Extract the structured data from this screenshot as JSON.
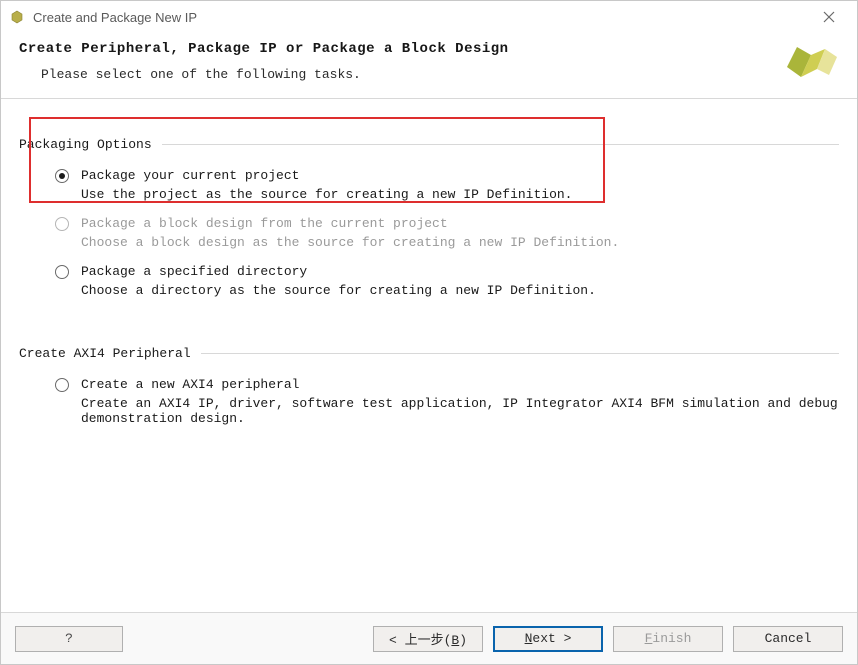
{
  "window": {
    "title": "Create and Package New IP"
  },
  "header": {
    "heading": "Create Peripheral, Package IP or Package a Block Design",
    "subhead": "Please select one of the following tasks."
  },
  "sections": {
    "packaging": {
      "title": "Packaging Options",
      "options": [
        {
          "line1": "Package your current project",
          "line2": "Use the project as the source for creating a new IP Definition.",
          "selected": true,
          "disabled": false
        },
        {
          "line1": "Package a block design from the current project",
          "line2": "Choose a block design as the source for creating a new IP Definition.",
          "selected": false,
          "disabled": true
        },
        {
          "line1": "Package a specified directory",
          "line2": "Choose a directory as the source for creating a new IP Definition.",
          "selected": false,
          "disabled": false
        }
      ]
    },
    "axi": {
      "title": "Create AXI4 Peripheral",
      "options": [
        {
          "line1": "Create a new AXI4 peripheral",
          "line2": "Create an AXI4 IP, driver, software test application, IP Integrator AXI4 BFM simulation and debug demonstration design.",
          "selected": false,
          "disabled": false
        }
      ]
    }
  },
  "footer": {
    "help": "?",
    "back_pre": "< 上一步(",
    "back_mn": "B",
    "back_post": ")",
    "next_mn": "N",
    "next_post": "ext >",
    "finish_mn": "F",
    "finish_post": "inish",
    "cancel": "Cancel"
  },
  "icons": {
    "app": "app-icon",
    "brand": "vivado-logo",
    "close": "close-icon"
  }
}
